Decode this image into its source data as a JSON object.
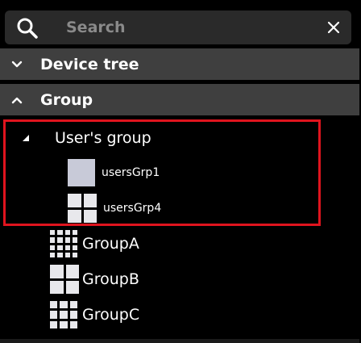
{
  "search": {
    "placeholder": "Search",
    "value": ""
  },
  "sections": {
    "device_tree": {
      "label": "Device tree",
      "expanded": false
    },
    "group": {
      "label": "Group",
      "expanded": true
    }
  },
  "tree": {
    "users_group": {
      "label": "User's group",
      "children": [
        {
          "label": "usersGrp1",
          "icon": "single-layout-icon"
        },
        {
          "label": "usersGrp4",
          "icon": "quad-layout-icon"
        }
      ]
    },
    "groups": [
      {
        "label": "GroupA",
        "icon": "grid-16-layout-icon"
      },
      {
        "label": "GroupB",
        "icon": "quad-layout-icon"
      },
      {
        "label": "GroupC",
        "icon": "grid-9-layout-icon"
      }
    ]
  },
  "colors": {
    "background": "#000000",
    "search_bg": "#2a2a2a",
    "header_bg": "#3f3f3f",
    "highlight": "#e0141e",
    "icon_fill": "#e8e8ec",
    "single_icon_fill": "#c8cad8"
  }
}
